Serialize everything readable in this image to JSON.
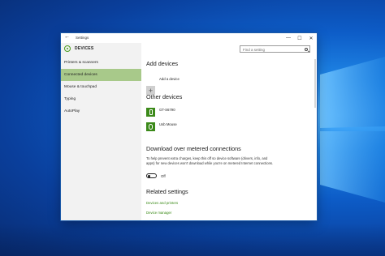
{
  "window": {
    "title": "Settings",
    "controls": [
      "—",
      "☐",
      "✕"
    ]
  },
  "sidebar": {
    "title": "DEVICES",
    "items": [
      {
        "label": "Printers & scanners",
        "active": false
      },
      {
        "label": "Connected devices",
        "active": true
      },
      {
        "label": "Mouse & touchpad",
        "active": false
      },
      {
        "label": "Typing",
        "active": false
      },
      {
        "label": "AutoPlay",
        "active": false
      }
    ]
  },
  "search": {
    "placeholder": "Find a setting"
  },
  "main": {
    "add_devices_heading": "Add devices",
    "add_device_label": "Add a device",
    "other_devices_heading": "Other devices",
    "devices": [
      {
        "name": "GT-S6790",
        "icon": "phone-icon"
      },
      {
        "name": "Usb Mouse",
        "icon": "mouse-icon"
      }
    ],
    "metered_heading": "Download over metered connections",
    "metered_text": "To help prevent extra charges, keep this off so device software (drivers, info, and apps) for new devices won't download while you're on metered Internet connections.",
    "toggle_state": "Off",
    "related_heading": "Related settings",
    "related_links": [
      "Devices and printers",
      "Device manager"
    ]
  },
  "colors": {
    "accent": "#4a9c1e",
    "active_item": "#a8c98a",
    "link": "#3a8a16",
    "desktop": "#0d5cc7"
  }
}
